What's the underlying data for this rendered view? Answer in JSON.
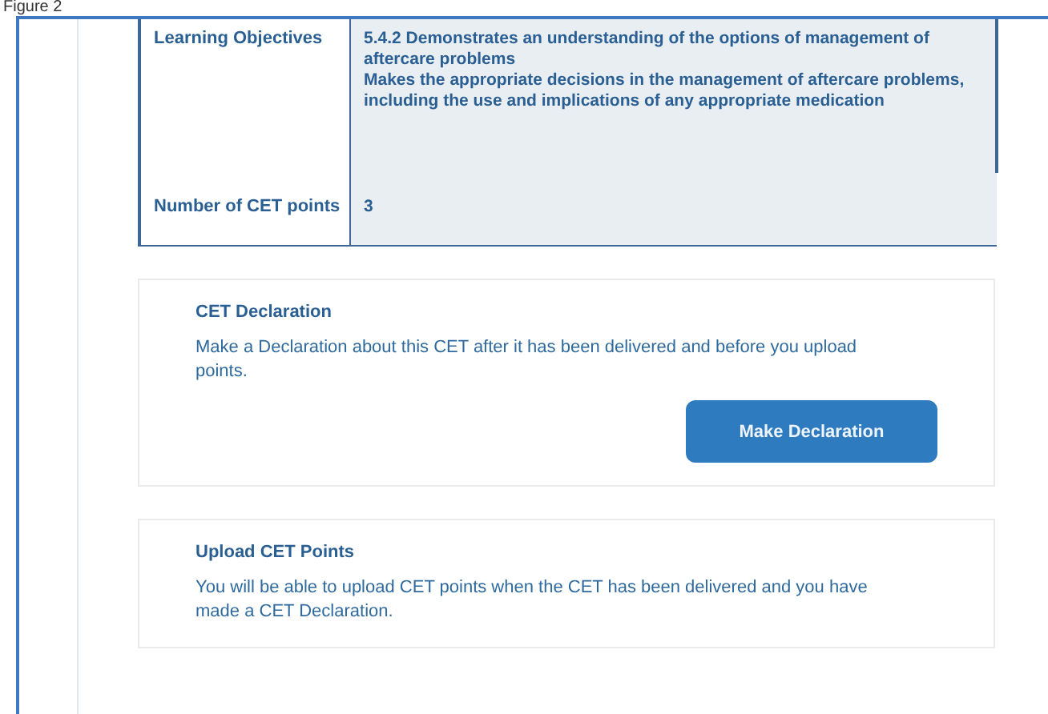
{
  "caption": "Figure 2",
  "details": [
    {
      "label": "Learning Objectives",
      "value": "5.4.2 Demonstrates an understanding of the options of management of aftercare problems\nMakes the appropriate decisions in the management of aftercare problems, including the use and implications of any appropriate medication"
    },
    {
      "label": "Number of CET points",
      "value": "3"
    }
  ],
  "cards": [
    {
      "title": "CET Declaration",
      "text": "Make a Declaration about this CET after it has been delivered and before you upload points.",
      "button": "Make Declaration"
    },
    {
      "title": "Upload CET Points",
      "text": "You will be able to upload CET points when the CET has been delivered and you have made a CET Declaration."
    }
  ]
}
